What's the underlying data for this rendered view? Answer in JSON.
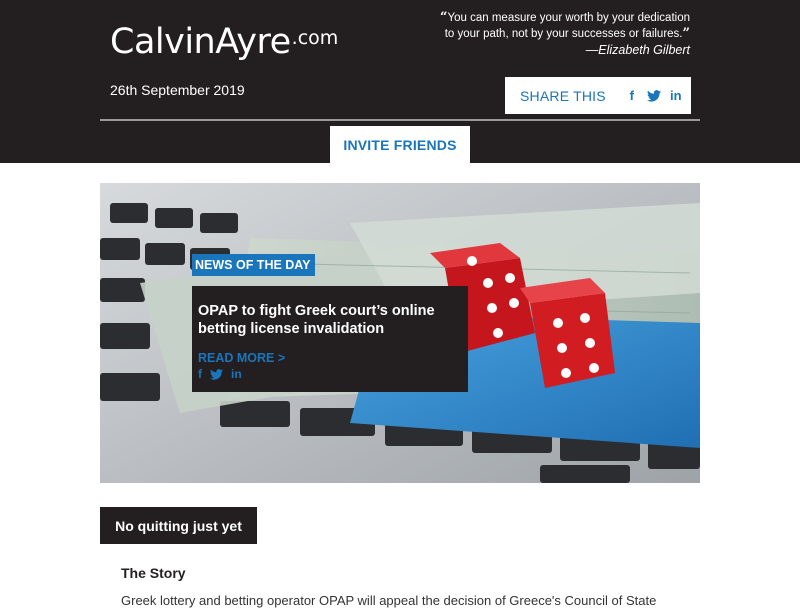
{
  "brand": {
    "name": "CalvinAyre",
    "tld": ".com"
  },
  "quote": {
    "open_mark": "“",
    "text": "You can measure your worth by your dedication to your path, not by your successes or failures.",
    "close_mark": "”",
    "author": "—Elizabeth Gilbert"
  },
  "date": "26th September 2019",
  "share": {
    "label": "SHARE THIS",
    "icons": {
      "facebook": "f",
      "twitter": "t",
      "linkedin": "in"
    }
  },
  "invite": {
    "label": "INVITE FRIENDS"
  },
  "featured": {
    "tag": "NEWS OF THE DAY",
    "title": "OPAP to fight Greek court’s online betting license invalidation",
    "read_more": "READ MORE >",
    "image_alt": "Dice on credit card and money on laptop keyboard"
  },
  "section": {
    "label": "No quitting just yet"
  },
  "story": {
    "heading": "The Story",
    "text": "Greek lottery and betting operator OPAP will appeal the decision of Greece's Council of State"
  },
  "colors": {
    "accent": "#1a75bb",
    "dark": "#231f20"
  }
}
